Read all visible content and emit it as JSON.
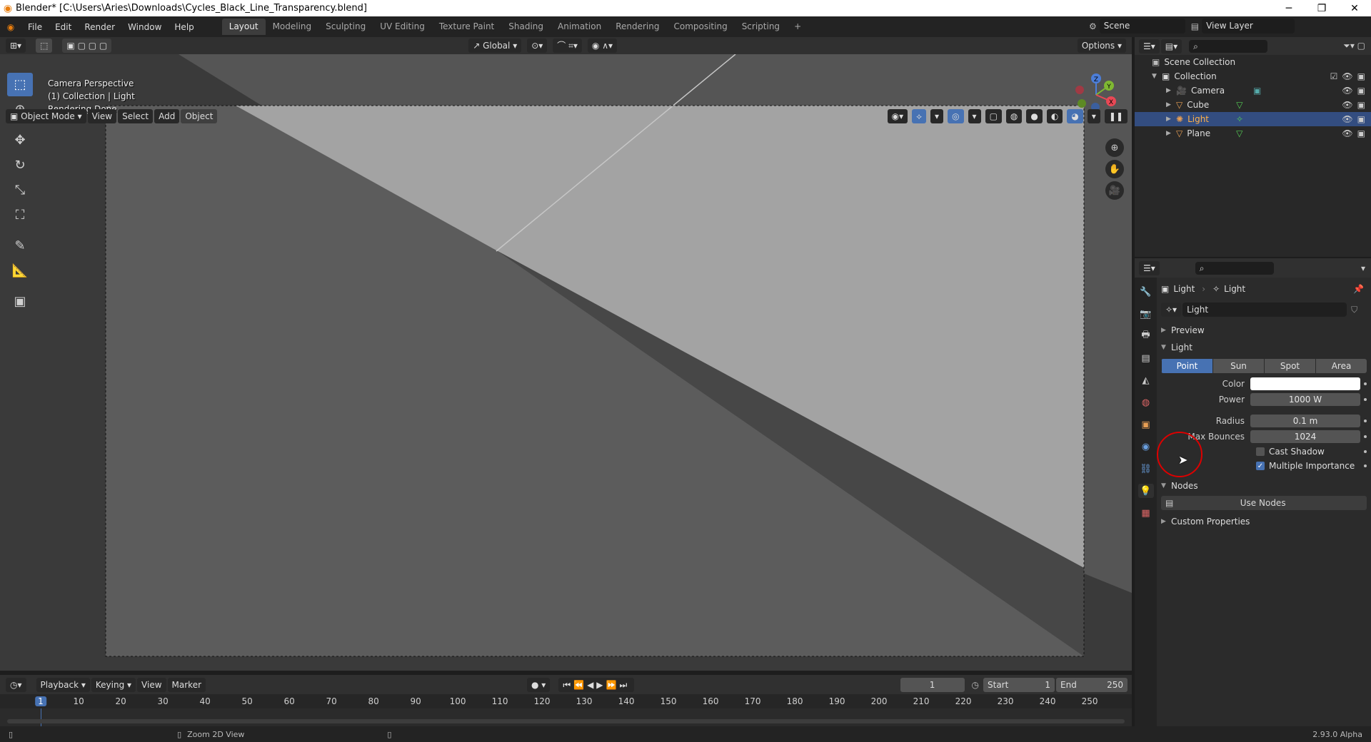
{
  "window": {
    "title": "Blender* [C:\\Users\\Aries\\Downloads\\Cycles_Black_Line_Transparency.blend]"
  },
  "menu": [
    "File",
    "Edit",
    "Render",
    "Window",
    "Help"
  ],
  "workspaces": [
    "Layout",
    "Modeling",
    "Sculpting",
    "UV Editing",
    "Texture Paint",
    "Shading",
    "Animation",
    "Rendering",
    "Compositing",
    "Scripting"
  ],
  "active_workspace": "Layout",
  "scene": {
    "name": "Scene",
    "view_layer": "View Layer"
  },
  "viewport": {
    "mode": "Object Mode",
    "menus": [
      "View",
      "Select",
      "Add",
      "Object"
    ],
    "orientation": "Global",
    "options": "Options",
    "overlay_lines": [
      "Camera Perspective",
      "(1) Collection | Light",
      "Rendering Done"
    ]
  },
  "gizmo": {
    "z": "Z",
    "y": "Y",
    "x": "X"
  },
  "outliner": {
    "root": "Scene Collection",
    "collection": "Collection",
    "items": [
      {
        "name": "Camera",
        "selected": false
      },
      {
        "name": "Cube",
        "selected": false
      },
      {
        "name": "Light",
        "selected": true
      },
      {
        "name": "Plane",
        "selected": false
      }
    ]
  },
  "properties": {
    "breadcrumb": [
      "Light",
      "Light"
    ],
    "datablock": "Light",
    "panels": {
      "preview": "Preview",
      "light": "Light",
      "nodes": "Nodes",
      "custom": "Custom Properties"
    },
    "light_types": [
      "Point",
      "Sun",
      "Spot",
      "Area"
    ],
    "active_type": "Point",
    "color_label": "Color",
    "color_value": "#ffffff",
    "power_label": "Power",
    "power": "1000 W",
    "radius_label": "Radius",
    "radius": "0.1 m",
    "bounces_label": "Max Bounces",
    "bounces": "1024",
    "cast_shadow": "Cast Shadow",
    "cast_shadow_checked": false,
    "multiple_importance": "Multiple Importance",
    "multiple_importance_checked": true,
    "use_nodes": "Use Nodes"
  },
  "timeline": {
    "menus": [
      "Playback",
      "Keying",
      "View",
      "Marker"
    ],
    "current_frame": "1",
    "start_label": "Start",
    "start": "1",
    "end_label": "End",
    "end": "250",
    "frames": [
      "1",
      "10",
      "20",
      "30",
      "40",
      "50",
      "60",
      "70",
      "80",
      "90",
      "100",
      "110",
      "120",
      "130",
      "140",
      "150",
      "160",
      "170",
      "180",
      "190",
      "200",
      "210",
      "220",
      "230",
      "240",
      "250"
    ]
  },
  "status": {
    "hint": "Zoom 2D View",
    "version": "2.93.0 Alpha"
  }
}
